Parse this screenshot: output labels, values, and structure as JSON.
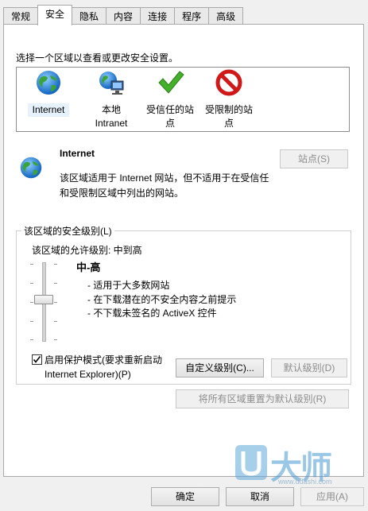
{
  "tabs": [
    "常规",
    "安全",
    "隐私",
    "内容",
    "连接",
    "程序",
    "高级"
  ],
  "instruction": "选择一个区域以查看或更改安全设置。",
  "zones": [
    {
      "label": "Internet",
      "icon": "globe-icon"
    },
    {
      "label": "本地\nIntranet",
      "icon": "intranet-icon"
    },
    {
      "label": "受信任的站\n点",
      "icon": "checkmark-icon"
    },
    {
      "label": "受限制的站\n点",
      "icon": "restricted-icon"
    }
  ],
  "selected_zone": {
    "title": "Internet",
    "description": "该区域适用于 Internet 网站，但不适用于在受信任和受限制区域中列出的网站。",
    "sites_button": "站点(S)"
  },
  "security_level": {
    "group_label": "该区域的安全级别(L)",
    "allowed_levels": "该区域的允许级别: 中到高",
    "level_name": "中-高",
    "bullets": [
      "- 适用于大多数网站",
      "- 在下载潜在的不安全内容之前提示",
      "- 不下载未签名的 ActiveX 控件"
    ],
    "slider_level": "中-高"
  },
  "protected_mode": {
    "checked": true,
    "label": "启用保护模式(要求重新启动\nInternet Explorer)(P)"
  },
  "buttons": {
    "custom_level": "自定义级别(C)...",
    "default_level": "默认级别(D)",
    "reset_all": "将所有区域重置为默认级别(R)",
    "ok": "确定",
    "cancel": "取消",
    "apply": "应用(A)"
  },
  "watermark": {
    "text": "大师",
    "url": "www.udashi.com"
  },
  "colors": {
    "accent": "#3399ff",
    "check_green": "#43b02a",
    "restricted_red": "#d01818"
  }
}
